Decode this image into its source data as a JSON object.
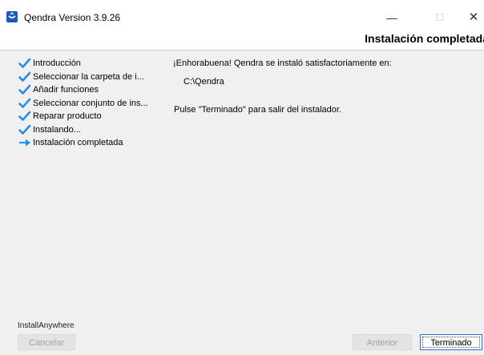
{
  "window": {
    "title": "Qendra Version 3.9.26",
    "app_icon": "qendra-app-icon",
    "controls": {
      "minimize": "—",
      "maximize": "☐",
      "close": "✕"
    }
  },
  "header": {
    "title": "Instalación completada"
  },
  "steps": [
    {
      "label": "Introducción",
      "status": "done",
      "icon": "check-icon"
    },
    {
      "label": "Seleccionar la carpeta de i...",
      "status": "done",
      "icon": "check-icon"
    },
    {
      "label": "Añadir funciones",
      "status": "done",
      "icon": "check-icon"
    },
    {
      "label": "Seleccionar conjunto de ins...",
      "status": "done",
      "icon": "check-icon"
    },
    {
      "label": "Reparar producto",
      "status": "done",
      "icon": "check-icon"
    },
    {
      "label": "Instalando...",
      "status": "done",
      "icon": "check-icon"
    },
    {
      "label": "Instalación completada",
      "status": "current",
      "icon": "arrow-right-icon"
    }
  ],
  "main": {
    "line1": "¡Enhorabuena! Qendra se instaló satisfactoriamente en:",
    "path": "C:\\Qendra",
    "line2": "Pulse \"Terminado\" para salir del instalador."
  },
  "brand": "InstallAnywhere",
  "buttons": {
    "cancel": "Cancelar",
    "previous": "Anterior",
    "finish": "Terminado"
  },
  "colors": {
    "check": "#2a8be0",
    "arrow": "#1c93e6",
    "focus_border": "#2e6ecf"
  }
}
